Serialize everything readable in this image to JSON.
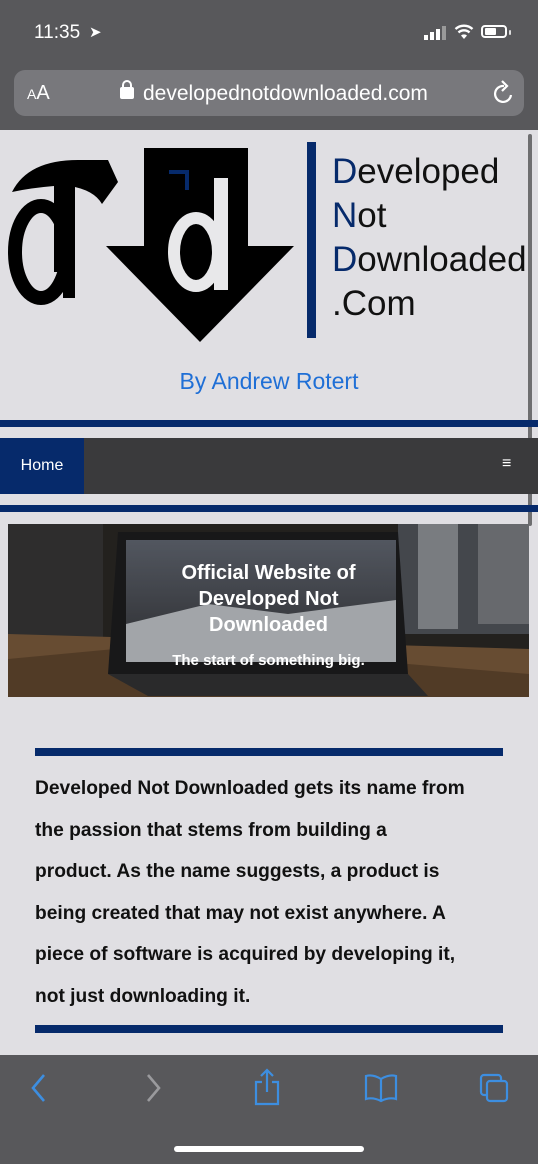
{
  "status_bar": {
    "time": "11:35",
    "location_arrow": "location-arrow-icon"
  },
  "browser": {
    "text_size_button": "AA",
    "url": "developednotdownloaded.com",
    "reload_icon": "reload-icon"
  },
  "site": {
    "logo": {
      "line1_initial": "D",
      "line1_rest": "eveloped",
      "line2_initial": "N",
      "line2_rest": "ot",
      "line3_initial": "D",
      "line3_rest": "ownloaded",
      "line4": ".Com"
    },
    "byline": "By Andrew Rotert",
    "nav": {
      "home": "Home",
      "menu_icon": "≡"
    },
    "hero": {
      "title_line1": "Official Website of",
      "title_line2": "Developed Not",
      "title_line3": "Downloaded",
      "tagline": "The start of something big."
    },
    "intro_lines": [
      "Developed Not Downloaded gets its name from",
      "the passion that stems from building a",
      "product. As the name suggests, a product is",
      "being created that may not exist anywhere. A",
      "piece of software is acquired by developing it,",
      "not just downloading it."
    ]
  },
  "toolbar": {
    "back": "back-icon",
    "forward": "forward-icon",
    "share": "share-icon",
    "bookmarks": "bookmarks-icon",
    "tabs": "tabs-icon"
  },
  "colors": {
    "brand_navy": "#062a6b",
    "link_blue": "#1f6fd6",
    "ios_blue": "#3d8ee0"
  }
}
